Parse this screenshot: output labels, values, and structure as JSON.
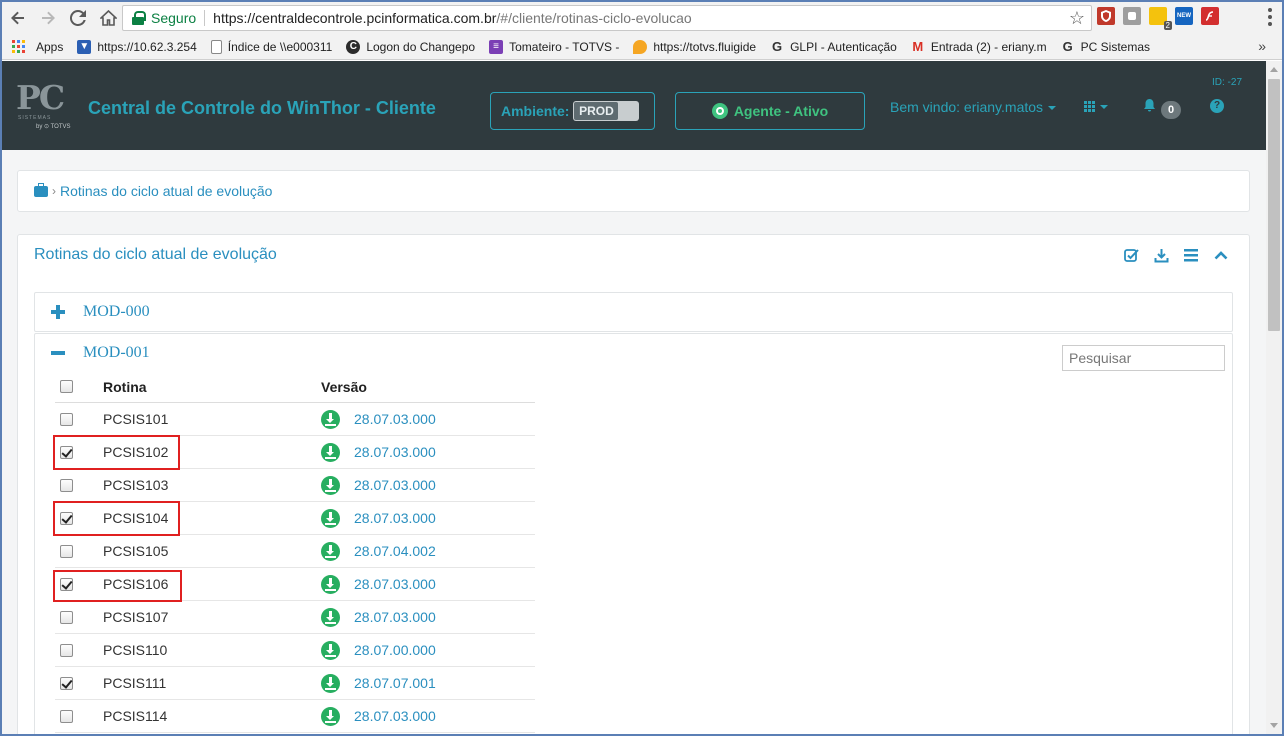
{
  "browser": {
    "secure_label": "Seguro",
    "url_host": "https://centraldecontrole.pcinformatica.com.br",
    "url_path": "/#/cliente/rotinas-ciclo-evolucao",
    "ext_badge": "2",
    "ext_new_label": "NEW",
    "bookmarks": [
      {
        "label": "Apps",
        "icon": "apps-grid-icon"
      },
      {
        "label": "https://10.62.3.254",
        "icon": "shield-icon",
        "color": "#2b5fb3"
      },
      {
        "label": "Índice de \\\\e000311",
        "icon": "document-icon",
        "color": "#888888"
      },
      {
        "label": "Logon do Changepo",
        "icon": "changepoint-icon",
        "color": "#2c2c2c"
      },
      {
        "label": "Tomateiro - TOTVS -",
        "icon": "list-icon",
        "color": "#7b3fb5"
      },
      {
        "label": "https://totvs.fluigide",
        "icon": "flame-icon",
        "color": "#f5a623"
      },
      {
        "label": "GLPI - Autenticação",
        "icon": "glpi-icon",
        "color": "#333333"
      },
      {
        "label": "Entrada (2) - eriany.m",
        "icon": "gmail-icon",
        "color": "#d93025"
      },
      {
        "label": "PC Sistemas",
        "icon": "pc-icon",
        "color": "#333333"
      }
    ],
    "more_label": "»"
  },
  "header": {
    "logo_text": "PC",
    "logo_sub": "SISTEMAS",
    "logo_by": "by ⊙ TOTVS",
    "title": "Central de Controle do WinThor - Cliente",
    "environment_label": "Ambiente:",
    "environment_value": "PROD",
    "agent_label": "Agente - Ativo",
    "welcome": "Bem vindo: eriany.matos",
    "notifications_count": "0",
    "id_label": "ID: -27",
    "help_label": "?"
  },
  "breadcrumb": {
    "separator": "›",
    "current": "Rotinas do ciclo atual de evolução"
  },
  "panel": {
    "title": "Rotinas do ciclo atual de evolução"
  },
  "modules": [
    {
      "name": "MOD-000",
      "expanded": false
    },
    {
      "name": "MOD-001",
      "expanded": true
    }
  ],
  "search": {
    "placeholder": "Pesquisar",
    "value": ""
  },
  "table": {
    "headers": {
      "rotina": "Rotina",
      "versao": "Versão"
    },
    "rows": [
      {
        "rotina": "PCSIS101",
        "versao": "28.07.03.000",
        "checked": false
      },
      {
        "rotina": "PCSIS102",
        "versao": "28.07.03.000",
        "checked": true
      },
      {
        "rotina": "PCSIS103",
        "versao": "28.07.03.000",
        "checked": false
      },
      {
        "rotina": "PCSIS104",
        "versao": "28.07.03.000",
        "checked": true
      },
      {
        "rotina": "PCSIS105",
        "versao": "28.07.04.002",
        "checked": false
      },
      {
        "rotina": "PCSIS106",
        "versao": "28.07.03.000",
        "checked": true
      },
      {
        "rotina": "PCSIS107",
        "versao": "28.07.03.000",
        "checked": false
      },
      {
        "rotina": "PCSIS110",
        "versao": "28.07.00.000",
        "checked": false
      },
      {
        "rotina": "PCSIS111",
        "versao": "28.07.07.001",
        "checked": true
      },
      {
        "rotina": "PCSIS114",
        "versao": "28.07.03.000",
        "checked": false
      }
    ]
  },
  "colors": {
    "header_bg": "#2f3a3e",
    "accent": "#2aa3b8",
    "link": "#2a8fbf",
    "success": "#27ae60",
    "annotation": "#e02020"
  }
}
